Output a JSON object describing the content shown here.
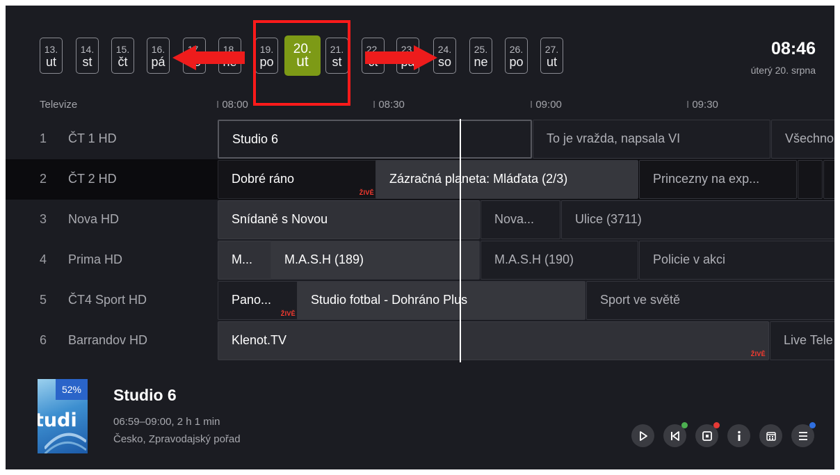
{
  "dates": [
    {
      "num": "13.",
      "day": "ut"
    },
    {
      "num": "14.",
      "day": "st"
    },
    {
      "num": "15.",
      "day": "čt"
    },
    {
      "num": "16.",
      "day": "pá"
    },
    {
      "num": "17.",
      "day": "so"
    },
    {
      "num": "18.",
      "day": "ne"
    },
    {
      "num": "19.",
      "day": "po"
    },
    {
      "num": "20.",
      "day": "ut",
      "selected": true
    },
    {
      "num": "21.",
      "day": "st"
    },
    {
      "num": "22.",
      "day": "čt"
    },
    {
      "num": "23.",
      "day": "pá"
    },
    {
      "num": "24.",
      "day": "so"
    },
    {
      "num": "25.",
      "day": "ne"
    },
    {
      "num": "26.",
      "day": "po"
    },
    {
      "num": "27.",
      "day": "ut"
    }
  ],
  "clock": {
    "time": "08:46",
    "date": "úterý 20. srpna"
  },
  "timeline": {
    "channel_header": "Televize",
    "ticks": [
      "08:00",
      "08:30",
      "09:00",
      "09:30"
    ]
  },
  "live_badge": "ŽIVĚ",
  "channels": [
    {
      "num": "1",
      "name": "ČT 1 HD",
      "programs": [
        "Studio 6",
        "To je vražda, napsala VI",
        "Všechno"
      ]
    },
    {
      "num": "2",
      "name": "ČT 2 HD",
      "programs": [
        "Dobré ráno",
        "Zázračná planeta: Mláďata (2/3)",
        "Princezny na exp...",
        "",
        ""
      ]
    },
    {
      "num": "3",
      "name": "Nova HD",
      "programs": [
        "Snídaně s Novou",
        "Nova...",
        "Ulice (3711)"
      ]
    },
    {
      "num": "4",
      "name": "Prima HD",
      "programs": [
        "M...",
        "M.A.S.H (189)",
        "M.A.S.H (190)",
        "Policie v akci"
      ]
    },
    {
      "num": "5",
      "name": "ČT4 Sport HD",
      "programs": [
        "Pano...",
        "Studio fotbal - Dohráno Plus",
        "Sport ve světě"
      ]
    },
    {
      "num": "6",
      "name": "Barrandov HD",
      "programs": [
        "Klenot.TV",
        "Live Tele"
      ]
    }
  ],
  "detail": {
    "title": "Studio 6",
    "time": "06:59–09:00, 2 h 1 min",
    "info": "Česko, Zpravodajský pořad",
    "progress_label": "52%",
    "progress": 0.52,
    "thumb_text": "tudi"
  },
  "controls": [
    "play-icon",
    "restart-icon",
    "record-icon",
    "info-icon",
    "calendar-icon",
    "menu-icon"
  ],
  "colors": {
    "accent": "#7d9a16",
    "live": "#ff3b2f",
    "highlight": "#ff1a1a",
    "dot_green": "#4caf50",
    "dot_red": "#e53935",
    "dot_blue": "#2f6fe0"
  }
}
